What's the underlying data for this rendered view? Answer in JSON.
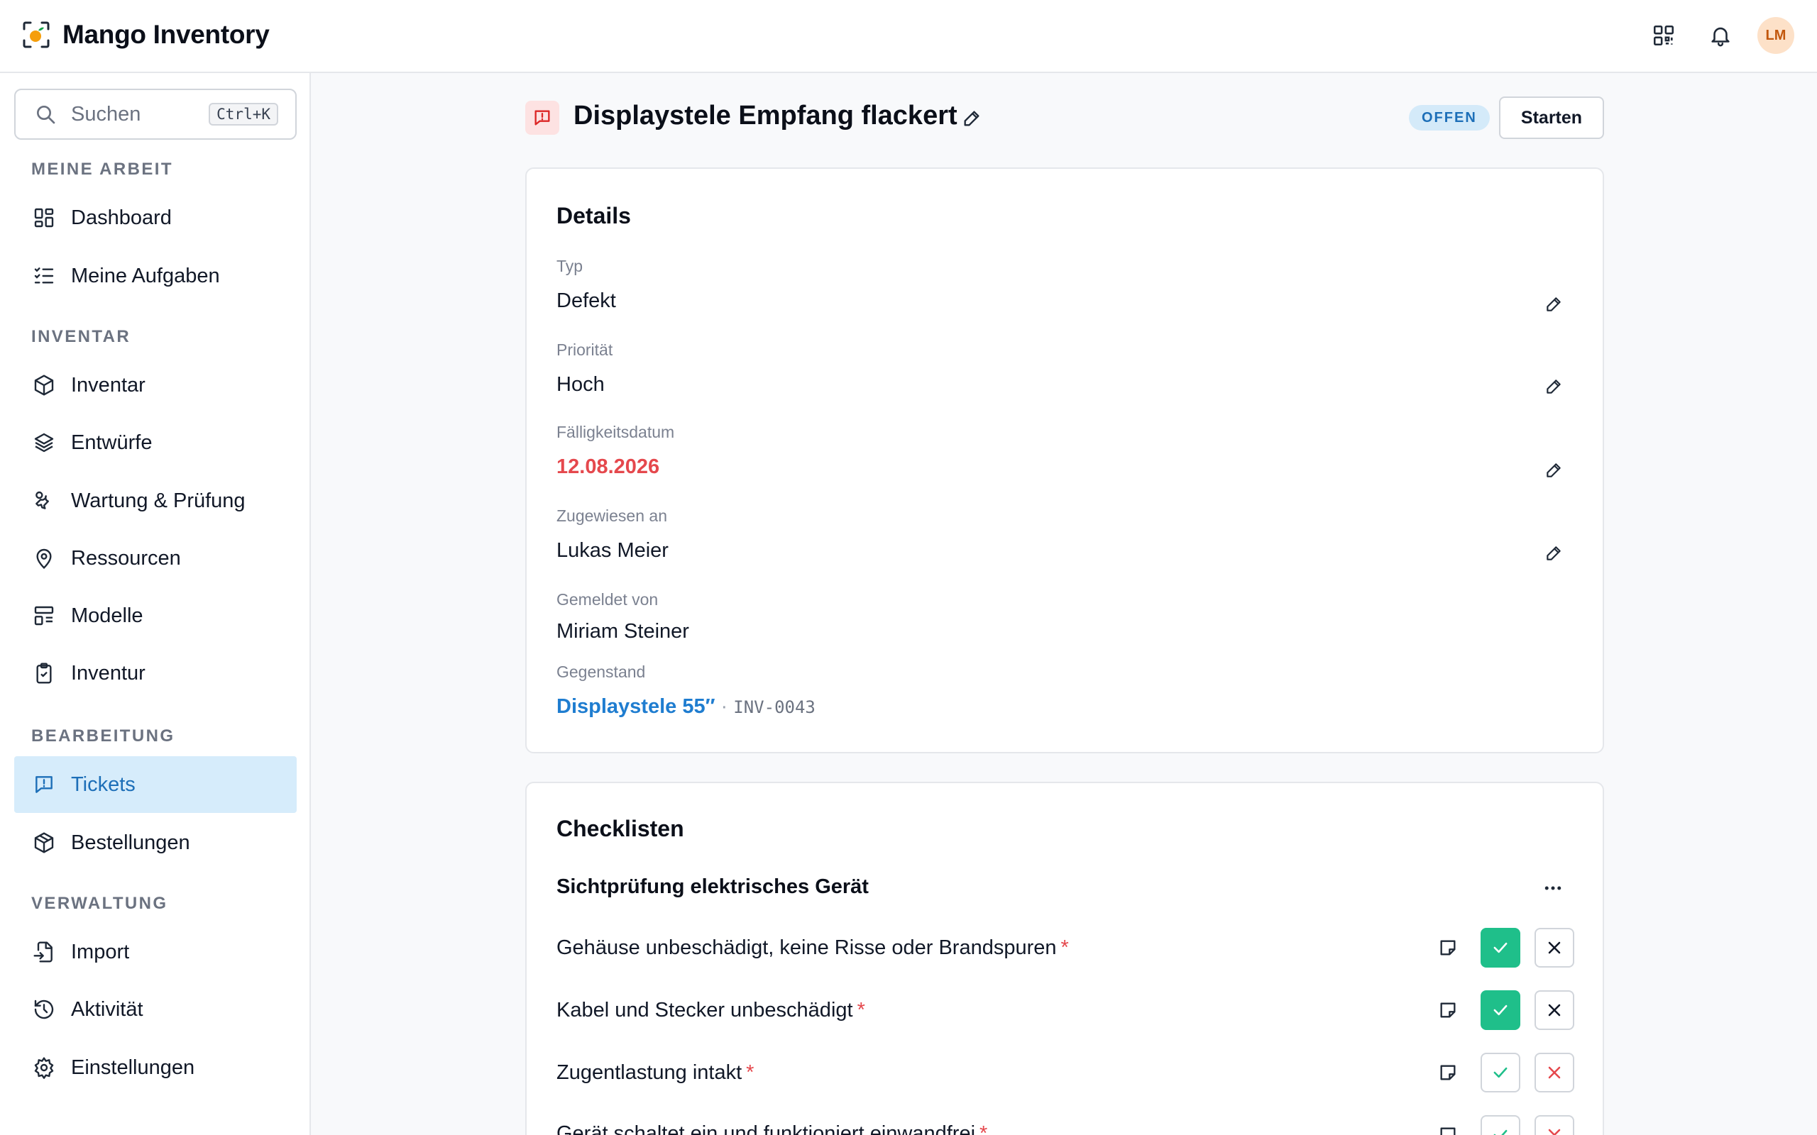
{
  "app": {
    "title": "Mango Inventory",
    "user_initials": "LM"
  },
  "header": {
    "qr_icon": "qr-code-icon",
    "bell_icon": "bell-icon"
  },
  "sidebar": {
    "search": {
      "placeholder": "Suchen",
      "shortcut": "Ctrl+K"
    },
    "sections": [
      {
        "label": "MEINE ARBEIT",
        "items": [
          {
            "label": "Dashboard",
            "icon": "dashboard-icon"
          },
          {
            "label": "Meine Aufgaben",
            "icon": "tasks-icon"
          }
        ]
      },
      {
        "label": "INVENTAR",
        "items": [
          {
            "label": "Inventar",
            "icon": "box-icon"
          },
          {
            "label": "Entwürfe",
            "icon": "layers-icon"
          },
          {
            "label": "Wartung & Prüfung",
            "icon": "wrench-icon"
          },
          {
            "label": "Ressourcen",
            "icon": "location-pin-icon"
          },
          {
            "label": "Modelle",
            "icon": "template-icon"
          },
          {
            "label": "Inventur",
            "icon": "clipboard-check-icon"
          }
        ]
      },
      {
        "label": "BEARBEITUNG",
        "items": [
          {
            "label": "Tickets",
            "icon": "ticket-alert-icon",
            "active": true
          },
          {
            "label": "Bestellungen",
            "icon": "package-icon"
          }
        ]
      },
      {
        "label": "VERWALTUNG",
        "items": [
          {
            "label": "Import",
            "icon": "file-import-icon"
          },
          {
            "label": "Aktivität",
            "icon": "history-icon"
          },
          {
            "label": "Einstellungen",
            "icon": "settings-gear-icon"
          }
        ]
      }
    ]
  },
  "ticket": {
    "title": "Displaystele Empfang flackert",
    "status": "OFFEN",
    "start_label": "Starten"
  },
  "details": {
    "title": "Details",
    "fields": [
      {
        "label": "Typ",
        "value": "Defekt"
      },
      {
        "label": "Priorität",
        "value": "Hoch"
      },
      {
        "label": "Fälligkeitsdatum",
        "value": "12.08.2026",
        "color": "#e5484d"
      },
      {
        "label": "Zugewiesen an",
        "value": "Lukas Meier"
      },
      {
        "label": "Gemeldet von",
        "value": "Miriam Steiner"
      },
      {
        "label": "Gegenstand",
        "value": "Displaystele 55″",
        "separator": "·",
        "code": "INV-0043"
      }
    ]
  },
  "checklists": {
    "title": "Checklisten",
    "group_title": "Sichtprüfung elektrisches Gerät",
    "required_mark": "*",
    "items": [
      {
        "label": "Gehäuse unbeschädigt, keine Risse oder Brandspuren",
        "state": "ok"
      },
      {
        "label": "Kabel und Stecker unbeschädigt",
        "state": "ok"
      },
      {
        "label": "Zugentlastung intakt",
        "state": "open"
      },
      {
        "label": "Gerät schaltet ein und funktioniert einwandfrei",
        "state": "open"
      }
    ]
  },
  "colors": {
    "accent": "#1d6fb8",
    "active_bg": "#d6ecfb",
    "success": "#1fbf8a",
    "danger": "#e5484d"
  }
}
